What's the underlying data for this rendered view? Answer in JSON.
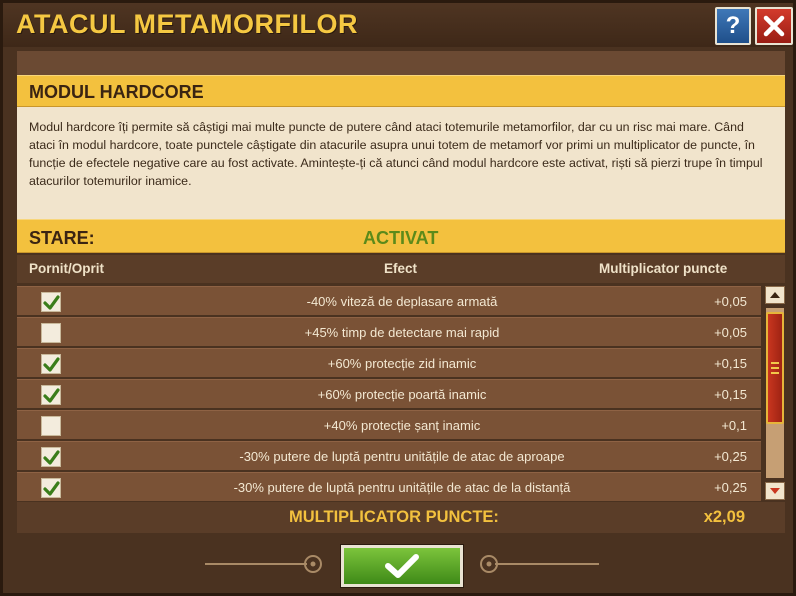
{
  "window": {
    "title": "ATACUL METAMORFILOR",
    "help_icon": "question-icon",
    "close_icon": "close-icon"
  },
  "section": {
    "title": "MODUL HARDCORE",
    "description": "Modul hardcore îți permite să câștigi mai multe puncte de putere când ataci totemurile metamorfilor, dar cu un risc mai mare. Când ataci în modul hardcore, toate punctele câștigate din atacurile asupra unui totem de metamorf vor primi un multiplicator de puncte, în funcție de efectele negative care au fost activate. Amintește-ți că atunci când modul hardcore este activat, riști să pierzi trupe în timpul atacurilor totemurilor inamice."
  },
  "status": {
    "label": "STARE:",
    "value": "ACTIVAT"
  },
  "columns": {
    "toggle": "Pornit/Oprit",
    "effect": "Efect",
    "multiplier": "Multiplicator puncte"
  },
  "effects": [
    {
      "checked": true,
      "effect": "-40% viteză de deplasare armată",
      "multiplier": "+0,05"
    },
    {
      "checked": false,
      "effect": "+45% timp de detectare mai rapid",
      "multiplier": "+0,05"
    },
    {
      "checked": true,
      "effect": "+60% protecție zid inamic",
      "multiplier": "+0,15"
    },
    {
      "checked": true,
      "effect": "+60% protecție poartă inamic",
      "multiplier": "+0,15"
    },
    {
      "checked": false,
      "effect": "+40% protecție șanț inamic",
      "multiplier": "+0,1"
    },
    {
      "checked": true,
      "effect": "-30% putere de luptă pentru unitățile de atac de aproape",
      "multiplier": "+0,25"
    },
    {
      "checked": true,
      "effect": "-30% putere de luptă pentru unitățile de atac de la distanță",
      "multiplier": "+0,25"
    }
  ],
  "total": {
    "label": "MULTIPLICATOR PUNCTE:",
    "value": "x2,09"
  },
  "confirm": {
    "icon": "checkmark-icon"
  },
  "colors": {
    "accent_yellow": "#f3c13e",
    "status_green": "#5b8a1a",
    "confirm_green": "#5fa82a",
    "close_red": "#c2301f",
    "help_blue": "#2f62a0"
  }
}
